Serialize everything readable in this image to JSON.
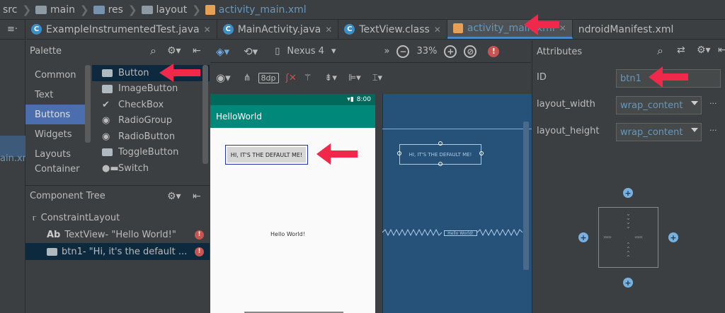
{
  "breadcrumb": [
    "src",
    "main",
    "res",
    "layout",
    "activity_main.xml"
  ],
  "tabs": [
    {
      "label": "ExampleInstrumentedTest.java",
      "icon": "c-class-icon"
    },
    {
      "label": "MainActivity.java",
      "icon": "c-class-icon"
    },
    {
      "label": "TextView.class",
      "icon": "c-class-icon"
    },
    {
      "label": "activity_main.xml",
      "icon": "layout-xml-icon",
      "active": true
    },
    {
      "label": "ndroidManifest.xml",
      "icon": "manifest-icon"
    }
  ],
  "palette": {
    "title": "Palette",
    "categories": [
      "Common",
      "Text",
      "Buttons",
      "Widgets",
      "Layouts",
      "Container"
    ],
    "selected_category": "Buttons",
    "items": [
      "Button",
      "ImageButton",
      "CheckBox",
      "RadioGroup",
      "RadioButton",
      "ToggleButton",
      "Switch"
    ],
    "selected_item": "Button"
  },
  "component_tree": {
    "title": "Component Tree",
    "rows": [
      {
        "label": "ConstraintLayout"
      },
      {
        "prefix": "Ab",
        "label": "TextView- \"Hello World!\""
      },
      {
        "label": "btn1- \"Hi, it's the default ..."
      }
    ]
  },
  "toolbar": {
    "device": "Nexus 4",
    "zoom": "33%",
    "margin": "8dp",
    "overflow": "»"
  },
  "preview": {
    "status_time": "8:00",
    "app_title": "HelloWorld",
    "button_text": "HI, IT'S THE DEFAULT ME!",
    "hello_text": "Hello World!",
    "blueprint_button_text": "HI, IT'S THE DEFAULT ME!",
    "blueprint_hello_text": "Hello World!"
  },
  "attributes": {
    "title": "Attributes",
    "id_label": "ID",
    "id_value": "btn1",
    "layout_width_label": "layout_width",
    "layout_width_value": "wrap_content",
    "layout_height_label": "layout_height",
    "layout_height_value": "wrap_content",
    "ellipsis": "···"
  },
  "colors": {
    "accent_red": "#f0284a",
    "selection_blue": "#4b6eaf",
    "blueprint": "#265178",
    "app_bar": "#00897b"
  }
}
